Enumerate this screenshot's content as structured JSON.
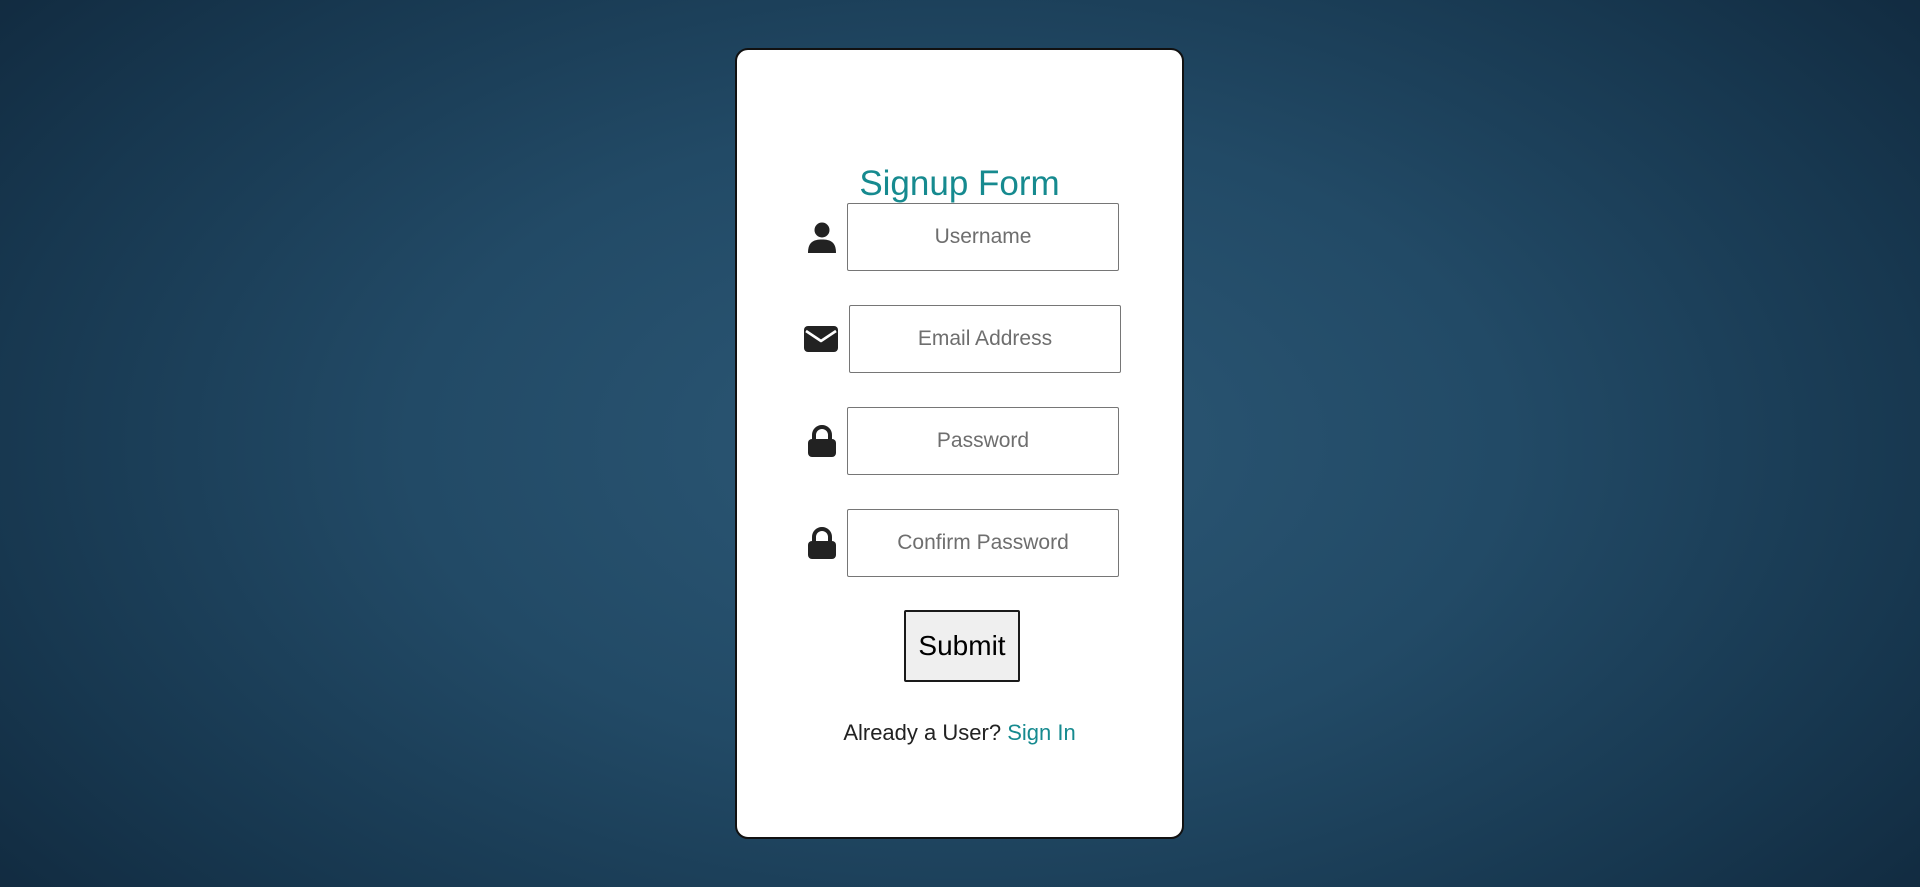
{
  "form": {
    "title": "Signup Form",
    "fields": [
      {
        "icon": "user-icon",
        "placeholder": "Username",
        "value": ""
      },
      {
        "icon": "envelope-icon",
        "placeholder": "Email Address",
        "value": ""
      },
      {
        "icon": "lock-icon",
        "placeholder": "Password",
        "value": ""
      },
      {
        "icon": "lock-icon",
        "placeholder": "Confirm Password",
        "value": ""
      }
    ],
    "submit_label": "Submit",
    "footer_text": "Already a User?",
    "signin_link": "Sign In"
  },
  "colors": {
    "accent": "#168a8f",
    "background": "#1f4a66",
    "card": "#ffffff",
    "icon": "#222222"
  }
}
